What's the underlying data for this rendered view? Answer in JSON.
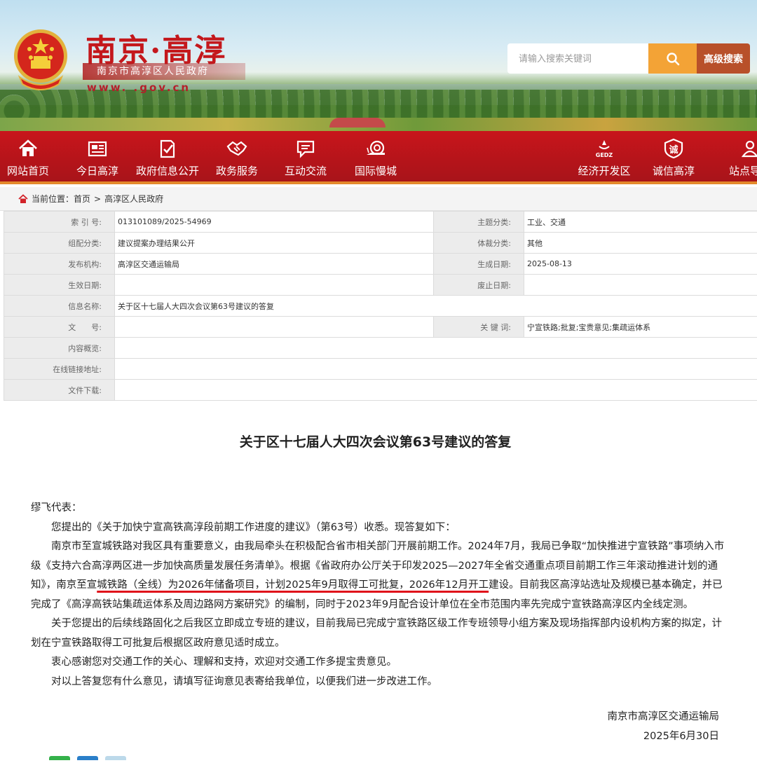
{
  "header": {
    "site_title": "南京·高淳",
    "site_subtitle": "南京市高淳区人民政府",
    "site_url": "www.          .gov.cn",
    "search_placeholder": "请输入搜索关键词",
    "advanced_search_label": "高级搜索",
    "search_icon": "magnifier-icon",
    "emblem": "national-emblem"
  },
  "nav": {
    "items": [
      {
        "label": "网站首页",
        "icon": "home-icon"
      },
      {
        "label": "今日高淳",
        "icon": "newspaper-icon"
      },
      {
        "label": "政府信息公开",
        "icon": "document-check-icon"
      },
      {
        "label": "政务服务",
        "icon": "handshake-icon"
      },
      {
        "label": "互动交流",
        "icon": "chat-icon"
      },
      {
        "label": "国际慢城",
        "icon": "snail-icon"
      },
      {
        "label": "经济开发区",
        "icon": "gedz-icon",
        "icon_text": "GEDZ"
      },
      {
        "label": "诚信高淳",
        "icon": "integrity-badge-icon",
        "icon_text": "诚"
      },
      {
        "label": "站点导航",
        "icon": "location-user-icon"
      }
    ]
  },
  "breadcrumb": {
    "prefix": "当前位置：",
    "home": "首页",
    "separator": ">",
    "current": "高淳区人民政府"
  },
  "meta": {
    "index_label": "索 引 号:",
    "index_value": "013101089/2025-54969",
    "topic_label": "主题分类:",
    "topic_value": "工业、交通",
    "group_label": "组配分类:",
    "group_value": "建议提案办理结果公开",
    "genre_label": "体裁分类:",
    "genre_value": "其他",
    "issuer_label": "发布机构:",
    "issuer_value": "高淳区交通运输局",
    "created_label": "生成日期:",
    "created_value": "2025-08-13",
    "effective_label": "生效日期:",
    "effective_value": "",
    "repeal_label": "废止日期:",
    "repeal_value": "",
    "name_label": "信息名称:",
    "name_value": "关于区十七届人大四次会议第63号建议的答复",
    "docno_label": "文　　号:",
    "docno_value": "",
    "keywords_label": "关 键 词:",
    "keywords_value": "宁宣铁路;批复;宝贵意见;集疏运体系",
    "summary_label": "内容概览:",
    "summary_value": "",
    "link_label": "在线链接地址:",
    "link_value": "",
    "download_label": "文件下载:",
    "download_value": ""
  },
  "article": {
    "title": "关于区十七届人大四次会议第63号建议的答复",
    "salutation": "缪飞代表：",
    "p1": "您提出的《关于加快宁宣高铁高淳段前期工作进度的建议》（第63号）收悉。现答复如下：",
    "p2a": "南京市至宣城铁路对我区具有重要意义，由我局牵头在积极配合省市相关部门开展前期工作。2024年7月，我局已争取“加快推进宁宣铁路”事项纳入市级《支持六合高淳两区进一步加快高质量发展任务清单》。根据《省政府办公厅关于印发2025—2027年全省交通重点项目前期工作三年滚动推进计划的通知》，南京至宣",
    "p2b": "城铁路（全线）为2026年储备项目，计划2025年9月取得工可批复，2026年12月开工",
    "p2c": "建设。目前我区高淳站选址及规模已基本确定，并已完成了《高淳高铁站集疏运体系及周边路网方案研究》的编制，同时于2023年9月配合设计单位在全市范围内率先完成宁宣铁路高淳区内全线定测。",
    "p3": "关于您提出的后续线路固化之后我区立即成立专班的建议，目前我局已完成宁宣铁路区级工作专班领导小组方案及现场指挥部内设机构方案的拟定，计划在宁宣铁路取得工可批复后根据区政府意见适时成立。",
    "p4": "衷心感谢您对交通工作的关心、理解和支持，欢迎对交通工作多提宝贵意见。",
    "p5": "对以上答复您有什么意见，请填写征询意见表寄给我单位，以便我们进一步改进工作。",
    "sign_unit": "南京市高淳区交通运输局",
    "sign_date": "2025年6月30日"
  },
  "colors": {
    "nav_red": "#c8151b",
    "title_red": "#c4181c",
    "search_orange": "#f3a336",
    "advanced_brown": "#b8502a",
    "highlight_underline": "#e0101a"
  }
}
